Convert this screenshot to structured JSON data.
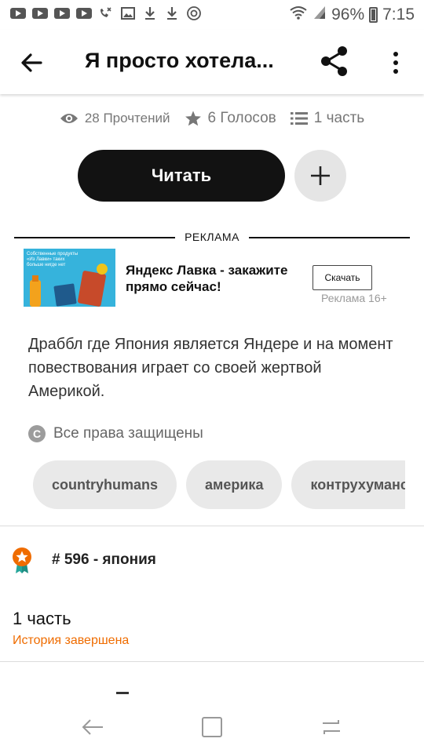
{
  "status_bar": {
    "battery": "96%",
    "time": "7:15",
    "left_icons": [
      "youtube-icon",
      "youtube-icon",
      "youtube-icon",
      "youtube-icon",
      "missed-call-icon",
      "image-icon",
      "download-icon",
      "download-icon",
      "target-icon"
    ]
  },
  "app_bar": {
    "title": "Я просто хотела..."
  },
  "stats": {
    "reads": "28 Прочтений",
    "votes": "6 Голосов",
    "parts": "1 часть"
  },
  "actions": {
    "read_label": "Читать"
  },
  "ad": {
    "label": "РЕКЛАМА",
    "image_text": "Собственные продукты «Из Лавки» таких больше нигде нет",
    "title": "Яндекс Лавка - закажите прямо сейчас!",
    "cta": "Скачать",
    "meta": "Реклама  16+"
  },
  "description": "Драббл где Япония является Яндере и на момент повествования играет со своей жертвой Америкой.",
  "rights": {
    "icon_letter": "C",
    "text": "Все права защищены"
  },
  "tags": [
    "countryhumans",
    "америка",
    "контрухуманс"
  ],
  "rank": {
    "text": "# 596 - япония"
  },
  "part": {
    "title": "1 часть",
    "status": "История завершена"
  },
  "colors": {
    "primary_button": "#121212",
    "accent_orange": "#ef6c00",
    "tag_bg": "#e9e9e9"
  }
}
